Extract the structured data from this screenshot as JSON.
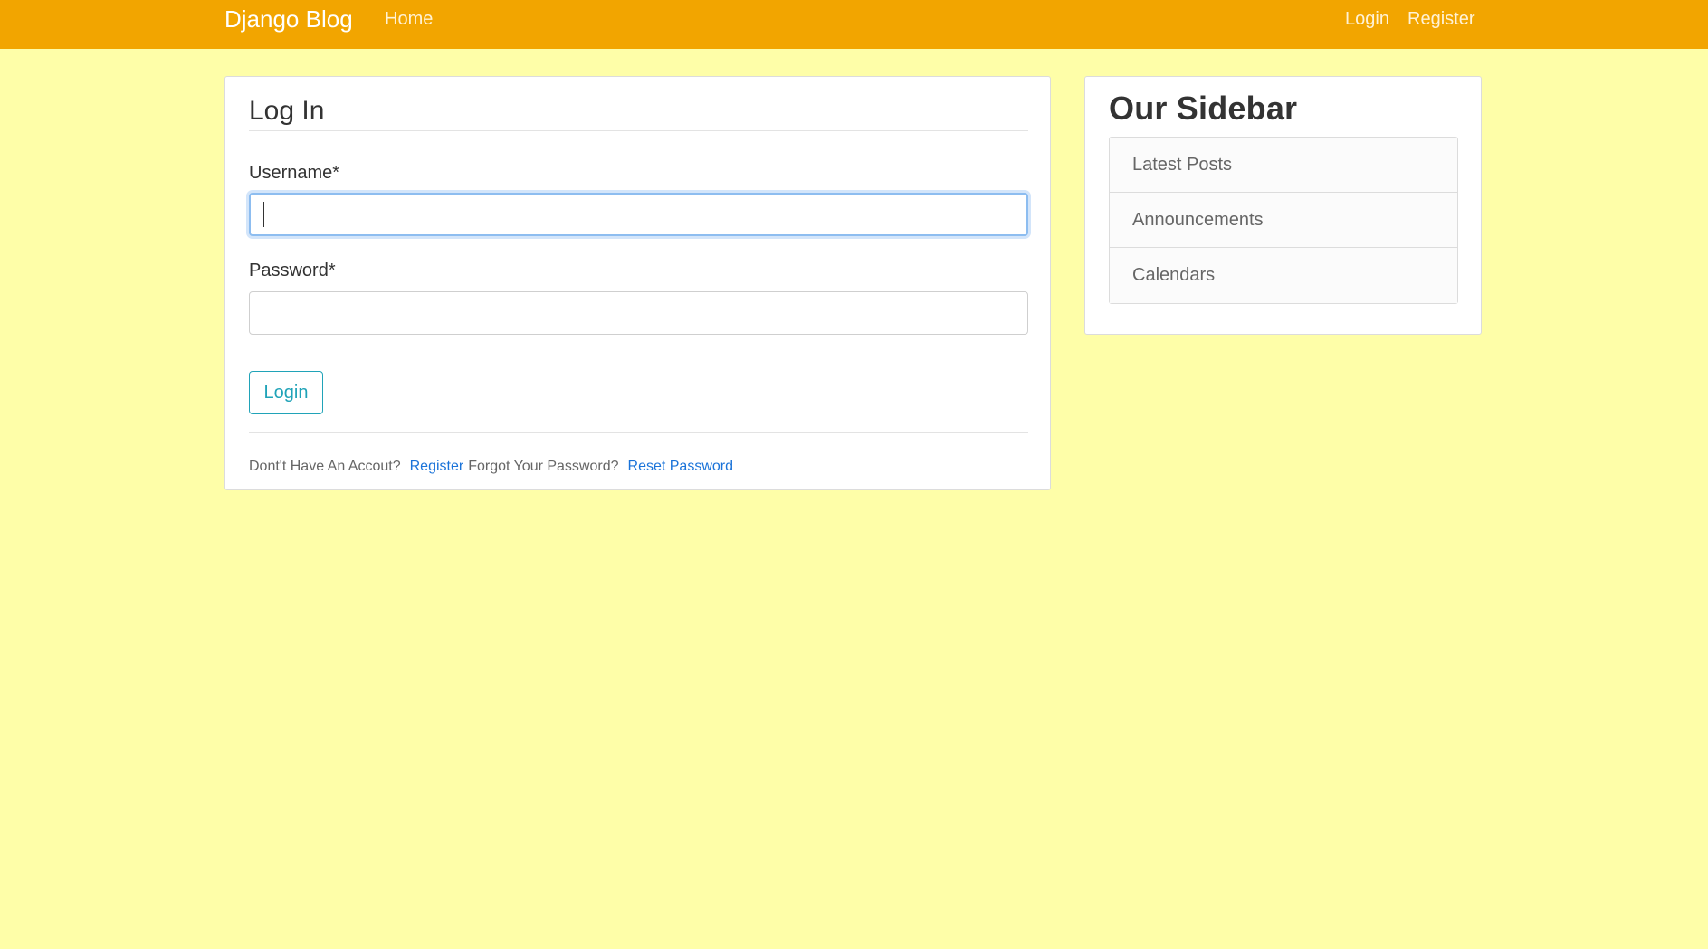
{
  "navbar": {
    "brand": "Django Blog",
    "home": "Home",
    "login": "Login",
    "register": "Register",
    "background_color": "#f2a500"
  },
  "page": {
    "background_color": "#fefea8"
  },
  "login_form": {
    "title": "Log In",
    "username_label": "Username*",
    "username_value": "",
    "password_label": "Password*",
    "password_value": "",
    "submit_label": "Login",
    "accent_color": "#20a3b8",
    "footer": {
      "no_account_text": "Dont't Have An Accout?",
      "register_link": "Register",
      "forgot_text": "Forgot Your Password?",
      "reset_link": "Reset Password",
      "link_color": "#1a73d9"
    }
  },
  "sidebar": {
    "title": "Our Sidebar",
    "items": [
      {
        "label": "Latest Posts"
      },
      {
        "label": "Announcements"
      },
      {
        "label": "Calendars"
      }
    ]
  }
}
